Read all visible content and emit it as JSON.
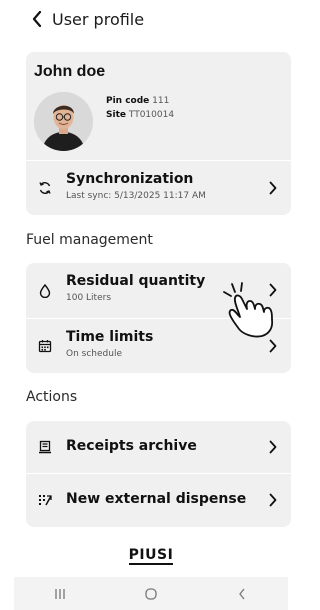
{
  "header": {
    "title": "User profile",
    "back_icon": "chevron-left-icon"
  },
  "profile": {
    "name": "John doe",
    "pin_label": "Pin code",
    "pin_value": "111",
    "site_label": "Site",
    "site_value": "TT010014"
  },
  "sync": {
    "icon": "sync-icon",
    "title": "Synchronization",
    "subtitle": "Last sync: 5/13/2025 11:17 AM"
  },
  "sections": {
    "fuel": "Fuel management",
    "actions": "Actions"
  },
  "fuel_items": [
    {
      "icon": "droplet-icon",
      "title": "Residual quantity",
      "subtitle": "100 Liters"
    },
    {
      "icon": "calendar-icon",
      "title": "Time limits",
      "subtitle": "On schedule"
    }
  ],
  "action_items": [
    {
      "icon": "receipt-icon",
      "title": "Receipts archive"
    },
    {
      "icon": "dispense-icon",
      "title": "New external dispense"
    }
  ],
  "brand": {
    "logo_text": "PIUSI"
  },
  "navbar": {
    "icons": [
      "recent-apps-icon",
      "home-icon",
      "back-icon"
    ]
  },
  "colors": {
    "card_bg": "#f0f0f0",
    "text": "#111111",
    "subtle": "#555555",
    "navbar_bg": "#f3f3f3"
  }
}
